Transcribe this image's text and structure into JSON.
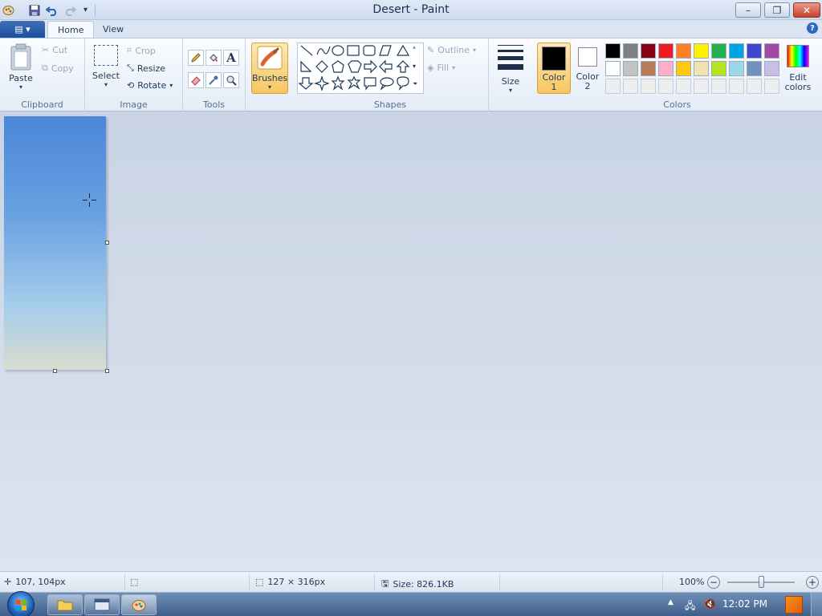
{
  "window": {
    "title": "Desert - Paint",
    "minimize": "–",
    "restore": "❐",
    "close": "✕"
  },
  "quick_access": {
    "app_icon": "paint-icon",
    "save_icon": "save-icon",
    "undo_icon": "undo-icon",
    "redo_icon": "redo-icon",
    "customize_icon": "dropdown-icon"
  },
  "ribbon_tabs": {
    "file_menu": "▤ ▾",
    "home": "Home",
    "view": "View",
    "help": "?"
  },
  "clipboard": {
    "paste": "Paste",
    "cut": "Cut",
    "copy": "Copy",
    "label": "Clipboard"
  },
  "image_group": {
    "select": "Select",
    "crop": "Crop",
    "resize": "Resize",
    "rotate": "Rotate",
    "label": "Image"
  },
  "tools_group": {
    "label": "Tools",
    "tools": [
      "pencil-icon",
      "fill-icon",
      "text-icon",
      "eraser-icon",
      "color-picker-icon",
      "magnifier-icon"
    ]
  },
  "brushes": {
    "label": "Brushes"
  },
  "shapes_group": {
    "outline": "Outline",
    "fill": "Fill",
    "label": "Shapes"
  },
  "size": {
    "label": "Size"
  },
  "colors_group": {
    "color1_line1": "Color",
    "color1_line2": "1",
    "color2_line1": "Color",
    "color2_line2": "2",
    "edit_line1": "Edit",
    "edit_line2": "colors",
    "label": "Colors",
    "color1": "#000000",
    "color2": "#ffffff",
    "row1": [
      "#000000",
      "#7f7f7f",
      "#880015",
      "#ed1c24",
      "#ff7f27",
      "#fff200",
      "#22b14c",
      "#00a2e8",
      "#3f48cc",
      "#a349a4"
    ],
    "row2": [
      "#ffffff",
      "#c3c3c3",
      "#b97a57",
      "#ffaec9",
      "#ffc90e",
      "#efe4b0",
      "#b5e61d",
      "#99d9ea",
      "#7092be",
      "#c8bfe7"
    ],
    "row3": [
      "#eeeeee",
      "#eeeeee",
      "#eeeeee",
      "#eeeeee",
      "#eeeeee",
      "#eeeeee",
      "#eeeeee",
      "#eeeeee",
      "#eeeeee",
      "#eeeeee"
    ]
  },
  "status": {
    "cursor_pos": "107, 104px",
    "image_size": "127 × 316px",
    "file_size": "Size: 826.1KB",
    "zoom": "100%",
    "zoom_level": 1.0
  },
  "taskbar": {
    "clock": "12:02 PM",
    "start": "start-orb"
  }
}
